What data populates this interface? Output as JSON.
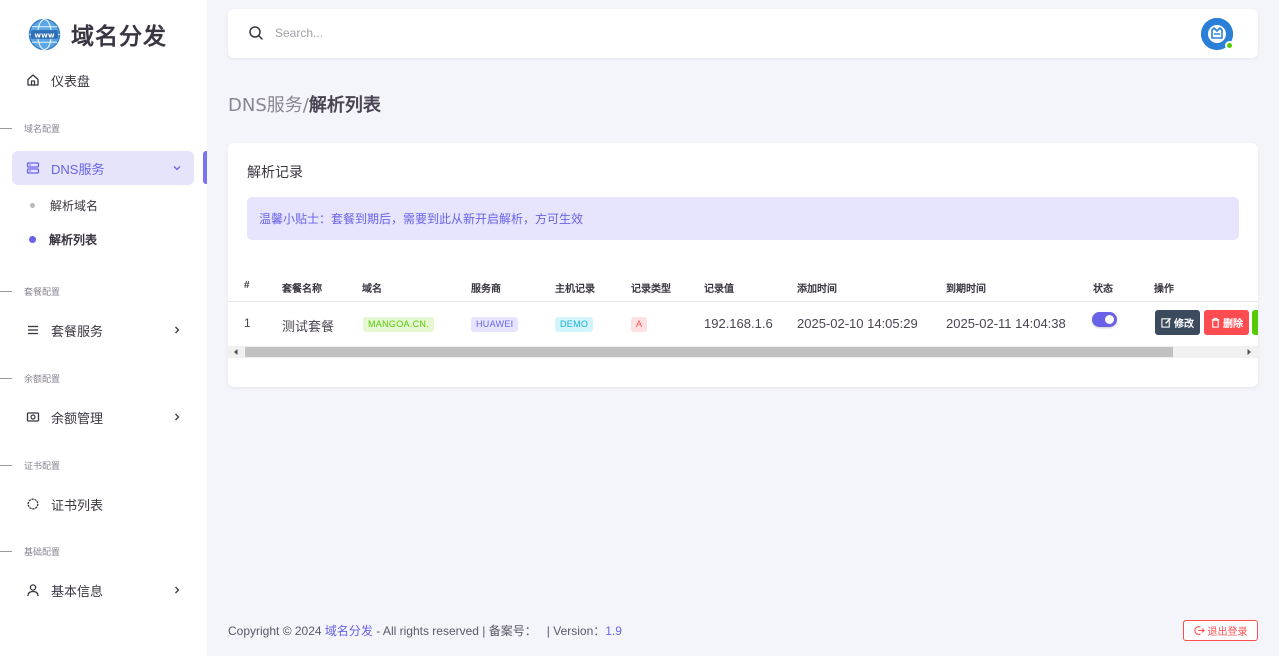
{
  "brand": {
    "title": "域名分发"
  },
  "sidebar": {
    "dashboard": "仪表盘",
    "sections": {
      "domain_config": "域名配置",
      "package_config": "套餐配置",
      "balance_config": "余额配置",
      "cert_config": "证书配置",
      "basic_config": "基础配置"
    },
    "dns_service": "DNS服务",
    "dns_sub": [
      "解析域名",
      "解析列表"
    ],
    "package_service": "套餐服务",
    "balance_manage": "余额管理",
    "cert_list": "证书列表",
    "basic_info": "基本信息"
  },
  "search": {
    "placeholder": "Search..."
  },
  "breadcrumb": {
    "parent": "DNS服务/",
    "current": "解析列表"
  },
  "card": {
    "title": "解析记录",
    "alert": "温馨小贴士：套餐到期后，需要到此从新开启解析，方可生效"
  },
  "table": {
    "headers": [
      "#",
      "套餐名称",
      "域名",
      "服务商",
      "主机记录",
      "记录类型",
      "记录值",
      "添加时间",
      "到期时间",
      "状态",
      "操作"
    ],
    "rows": [
      {
        "id": "1",
        "package": "测试套餐",
        "domain": "MANGOA.CN.",
        "provider": "HUAWEI",
        "host": "DEMO",
        "type": "A",
        "value": "192.168.1.6",
        "added": "2025-02-10 14:05:29",
        "expires": "2025-02-11 14:04:38",
        "status_on": true,
        "edit_label": "修改",
        "delete_label": "删除"
      }
    ]
  },
  "footer": {
    "copyright": "Copyright © 2024",
    "site_link": "域名分发",
    "rights": "- All rights reserved | 备案号：",
    "version_label": "| Version：",
    "version": "1.9"
  },
  "logout": {
    "label": "退出登录"
  },
  "colors": {
    "primary": "#6962e9",
    "danger": "#ff4c51",
    "dark": "#3b4a5d",
    "success": "#56ca00"
  }
}
